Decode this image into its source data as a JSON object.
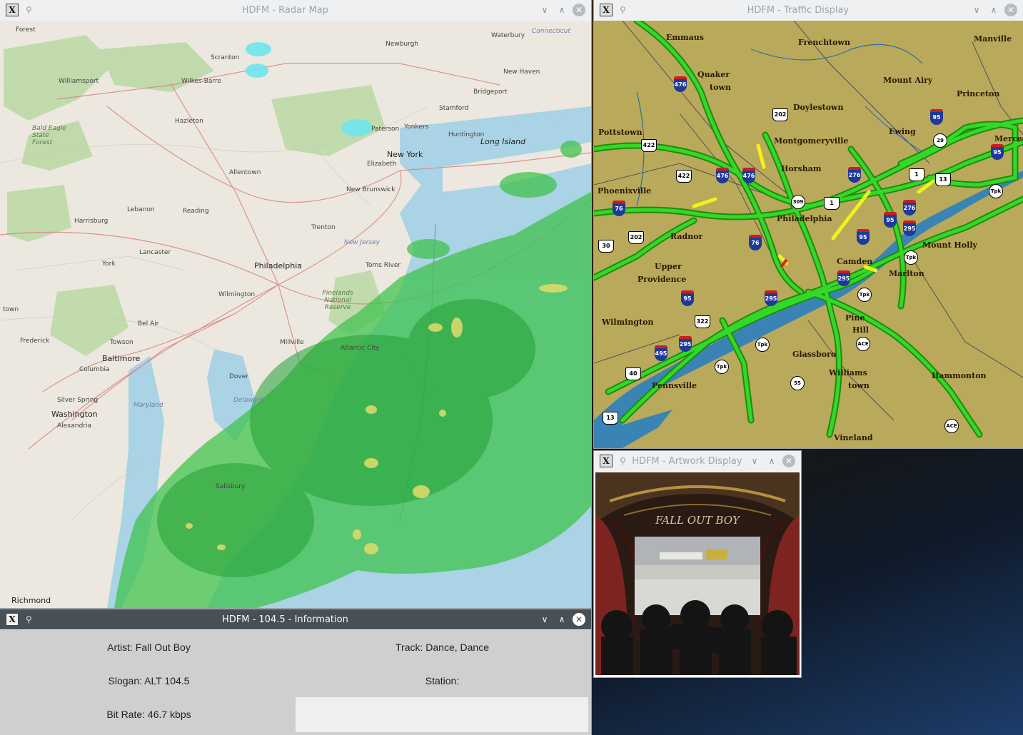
{
  "windows": {
    "radar": {
      "title": "HDFM - Radar Map",
      "labels": [
        "Forest",
        "Connecticut",
        "Waterbury",
        "Newburgh",
        "Scranton",
        "Williamsport",
        "Wilkes-Barre",
        "New Haven",
        "Bridgeport",
        "Stamford",
        "Hazleton",
        "Paterson",
        "Yonkers",
        "Huntington",
        "Long Island",
        "New York",
        "Elizabeth",
        "Bald Eagle State Forest",
        "Allentown",
        "New Brunswick",
        "Lebanon",
        "Reading",
        "Harrisburg",
        "Trenton",
        "New Jersey",
        "Lancaster",
        "Philadelphia",
        "York",
        "Toms River",
        "Wilmington",
        "Pinelands National Reserve",
        "Bel Air",
        "Frederick",
        "Towson",
        "Baltimore",
        "Atlantic City",
        "Millville",
        "Columbia",
        "Dover",
        "Delaware",
        "Silver Spring",
        "Washington",
        "Alexandria",
        "Maryland",
        "Salisbury",
        "Richmond",
        "town"
      ]
    },
    "traffic": {
      "title": "HDFM - Traffic Display",
      "towns": [
        "Emmaus",
        "Frenchtown",
        "Manville",
        "Quaker",
        "town",
        "Mount Airy",
        "Princeton",
        "Doylestown",
        "Pottstown",
        "Ewing",
        "Mercer",
        "Montgomeryville",
        "Horsham",
        "Phoenixville",
        "Philadelphia",
        "Radnor",
        "Mount Holly",
        "Upper",
        "Providence",
        "Camden",
        "Marlton",
        "Wilmington",
        "Pine",
        "Hill",
        "Glassboro",
        "Williams",
        "town",
        "Hammonton",
        "Pennsville",
        "Vineland"
      ],
      "shields": {
        "interstate": [
          "476",
          "95",
          "476",
          "476",
          "276",
          "76",
          "95",
          "276",
          "95",
          "295",
          "76",
          "95",
          "295",
          "95",
          "295",
          "495",
          "295"
        ],
        "us": [
          "202",
          "422",
          "422",
          "1",
          "202",
          "30",
          "1",
          "13",
          "322",
          "40",
          "13"
        ],
        "circle": [
          "309",
          "29",
          "Tpk",
          "Tpk",
          "Tpk",
          "ACE",
          "55",
          "Tpk",
          "Tpk",
          "ACE"
        ]
      }
    },
    "artwork": {
      "title": "HDFM - Artwork Display",
      "album_text": "FALL OUT BOY"
    },
    "info": {
      "title": "HDFM - 104.5 - Information",
      "artist": "Artist: Fall Out Boy",
      "track": "Track: Dance, Dance",
      "slogan": "Slogan: ALT 104.5",
      "station": "Station:",
      "bitrate": "Bit Rate: 46.7 kbps"
    }
  },
  "titlebar_buttons": {
    "minimize": "∨",
    "maximize": "∧",
    "close": "✕",
    "pin": "📌",
    "app": "X"
  },
  "colors": {
    "active_titlebar": "#475057",
    "inactive_titlebar": "#eff0f1",
    "traffic_bg": "#b9a95a",
    "traffic_road": "#22c41a",
    "traffic_slow": "#f2f21a",
    "radar_rain": "#3cc24a",
    "water": "#a9cbe0"
  }
}
